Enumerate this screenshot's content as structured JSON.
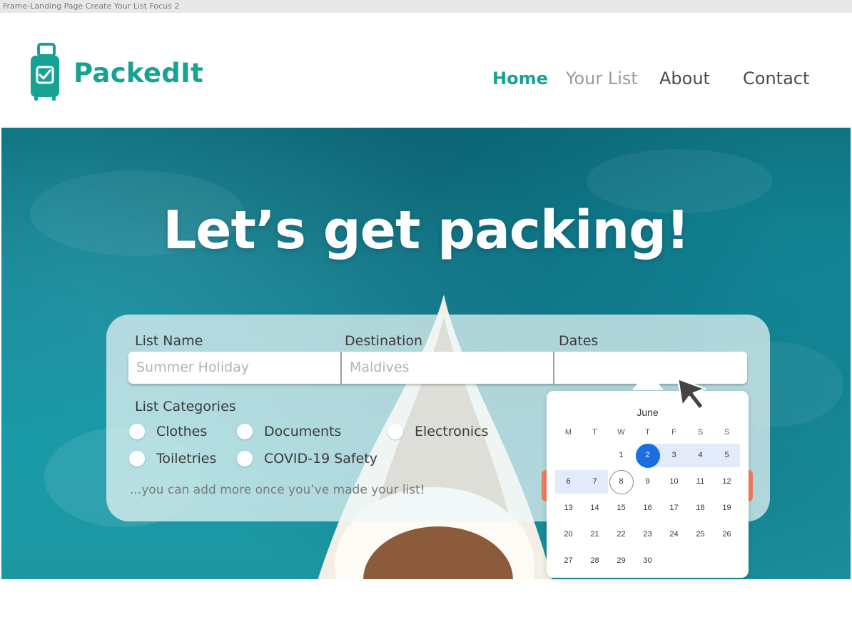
{
  "frame_label": "Frame-Landing Page Create Your List Focus 2",
  "brand": {
    "name": "PackedIt",
    "color": "#17a394",
    "icon": "suitcase-check-icon"
  },
  "nav": {
    "home": "Home",
    "your_list": "Your List",
    "about": "About",
    "contact": "Contact"
  },
  "hero": {
    "headline": "Let’s get packing!"
  },
  "form": {
    "list_name_label": "List Name",
    "list_name_placeholder": "Summer Holiday",
    "destination_label": "Destination",
    "destination_placeholder": "Maldives",
    "dates_label": "Dates",
    "dates_value": "",
    "categories_label": "List Categories",
    "categories": [
      "Clothes",
      "Documents",
      "Electronics",
      "Toiletries",
      "COVID-19 Safety"
    ],
    "hint": "...you can add more once you’ve made your list!"
  },
  "calendar": {
    "month": "June",
    "weekdays": [
      "M",
      "T",
      "W",
      "T",
      "F",
      "S",
      "S"
    ],
    "weeks": [
      [
        "",
        "",
        "1",
        "2",
        "3",
        "4",
        "5"
      ],
      [
        "6",
        "7",
        "8",
        "9",
        "10",
        "11",
        "12"
      ],
      [
        "13",
        "14",
        "15",
        "16",
        "17",
        "18",
        "19"
      ],
      [
        "20",
        "21",
        "22",
        "23",
        "24",
        "25",
        "26"
      ],
      [
        "27",
        "28",
        "29",
        "30",
        "",
        "",
        ""
      ]
    ],
    "selected_day": "2",
    "today": "8",
    "range_start": "2",
    "range_end": "7",
    "selected_color": "#1a6fe0",
    "range_color": "#e3eafa"
  },
  "colors": {
    "accent": "#17a394",
    "cta": "#ee7d5e"
  }
}
